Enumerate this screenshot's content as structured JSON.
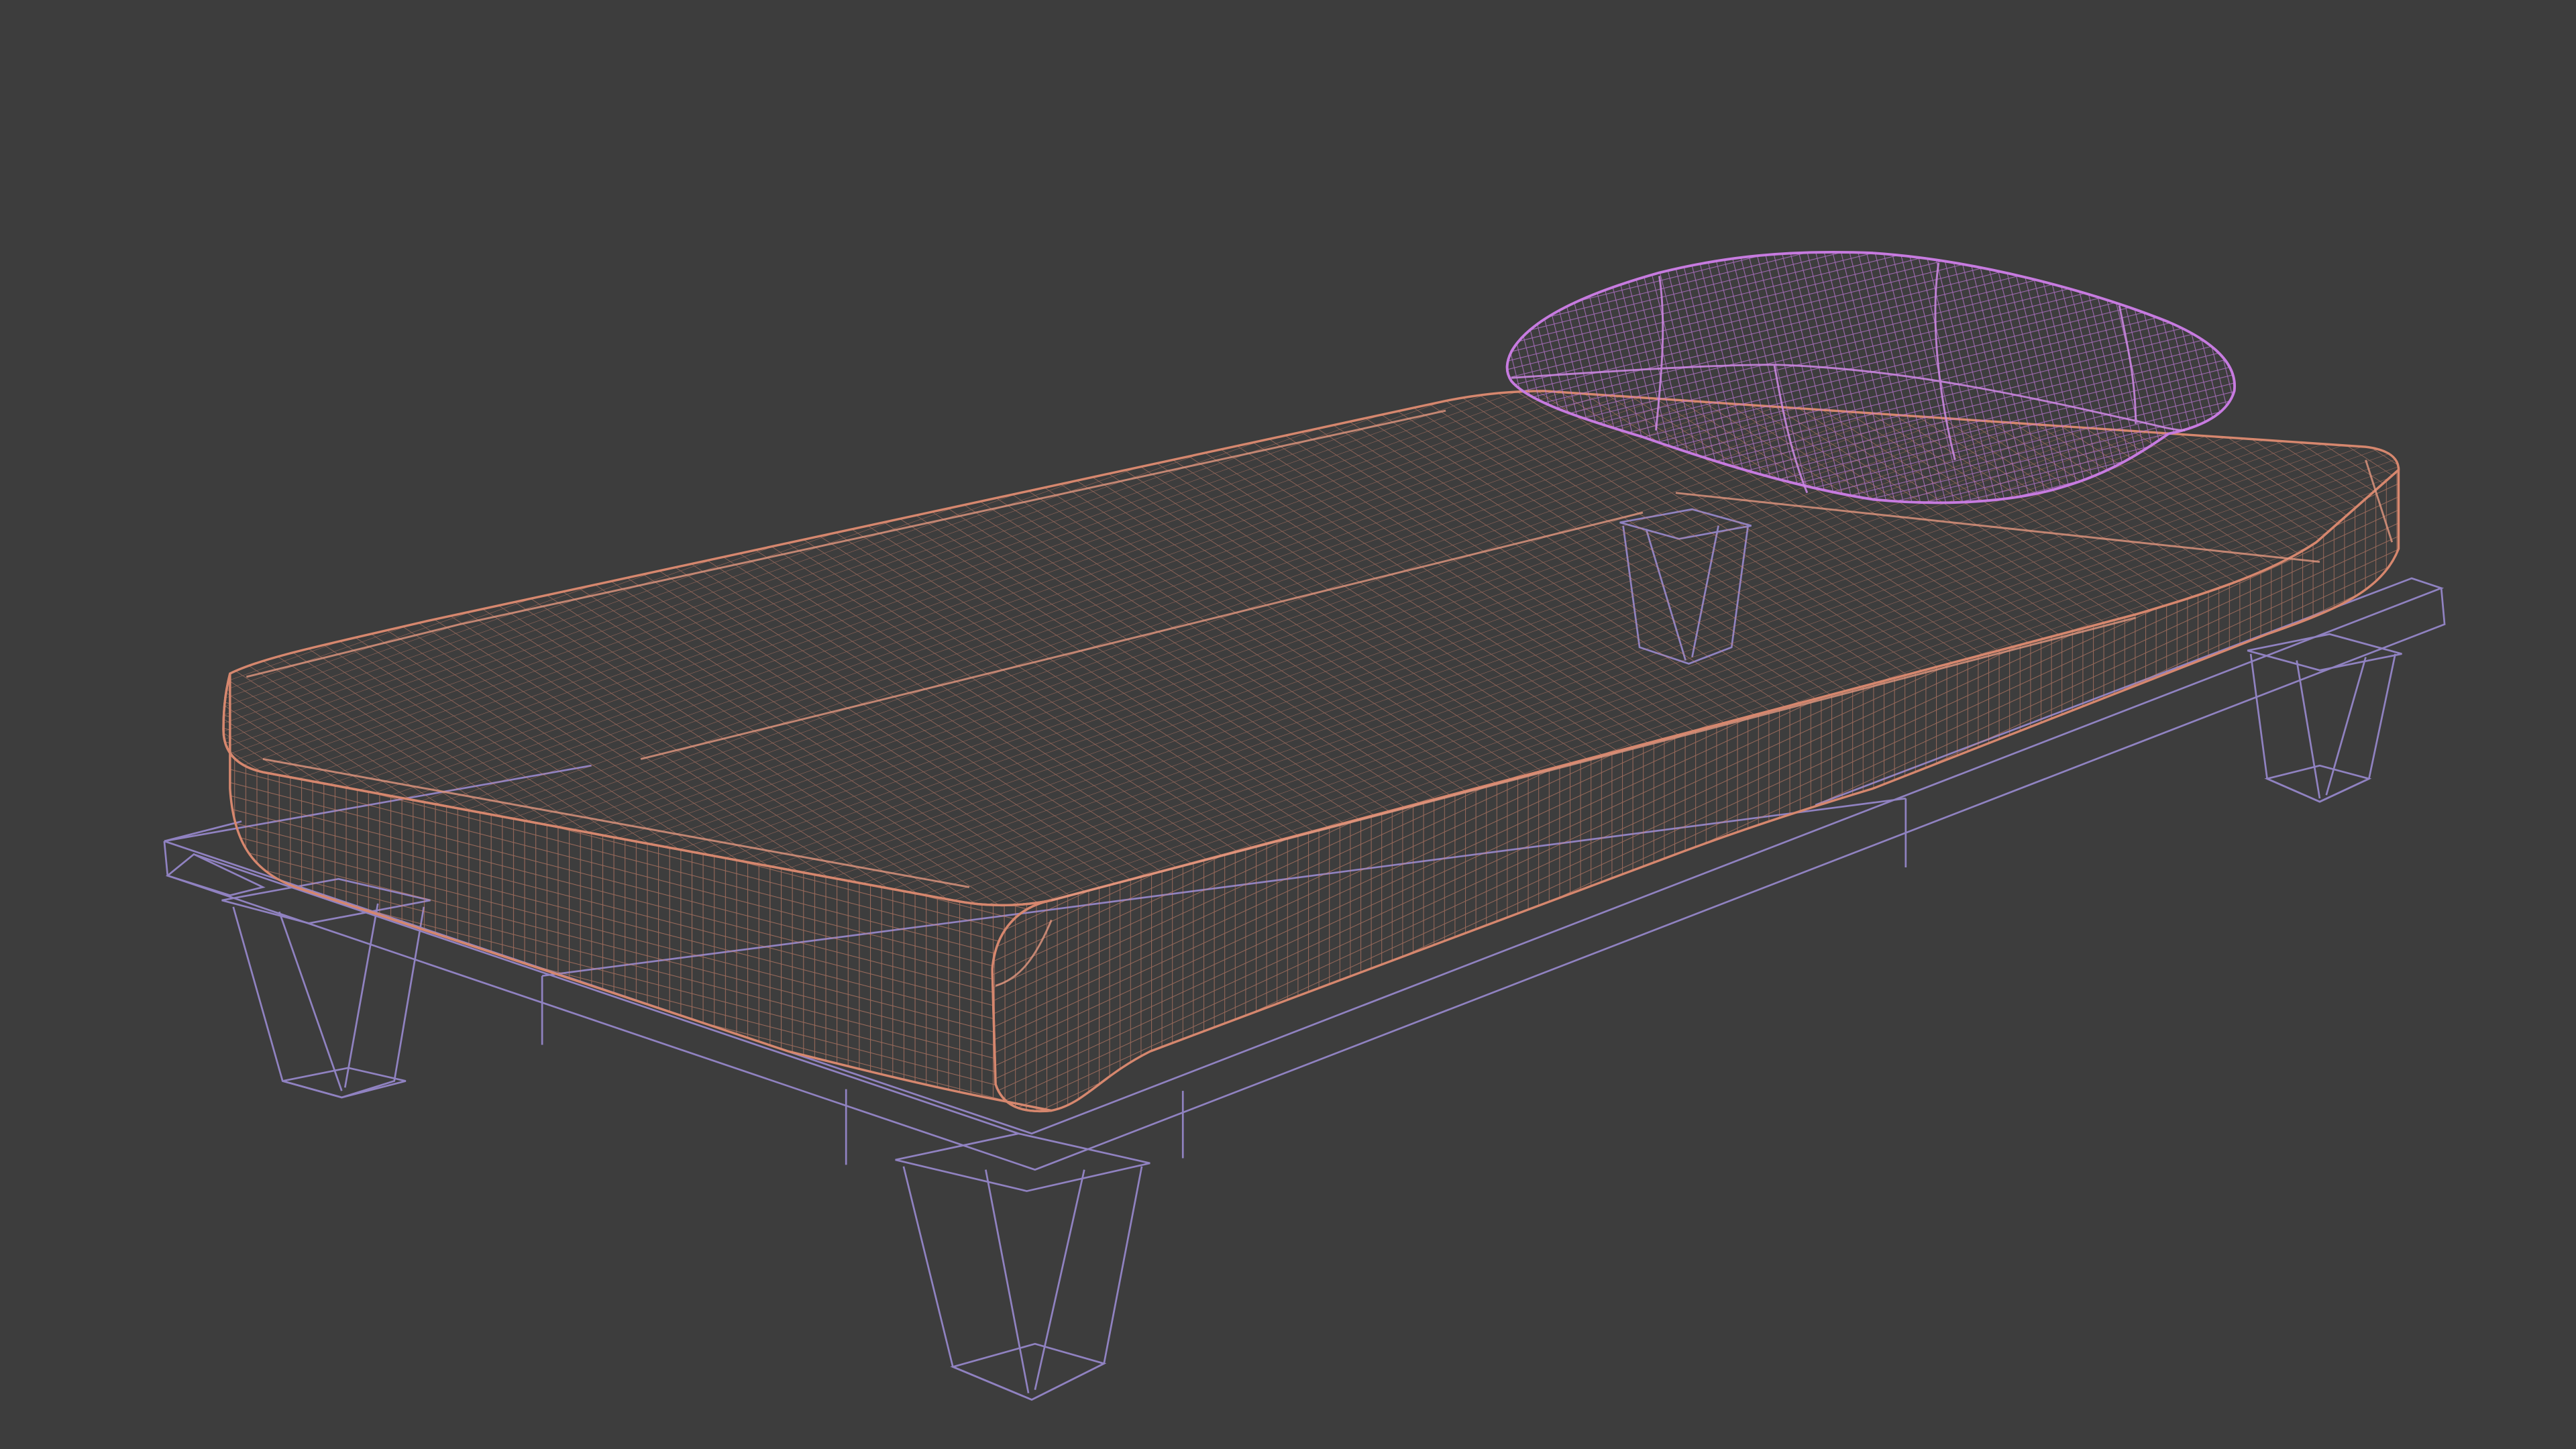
{
  "viewport": {
    "name": "3D Viewport",
    "shading_mode": "wireframe",
    "background_color": "#3d3d3d"
  },
  "objects": [
    {
      "name": "mattress",
      "wire_color": "#d6876e"
    },
    {
      "name": "pillow",
      "wire_color": "#c77be0"
    },
    {
      "name": "bed-frame",
      "wire_color": "#9f8fd9"
    }
  ]
}
